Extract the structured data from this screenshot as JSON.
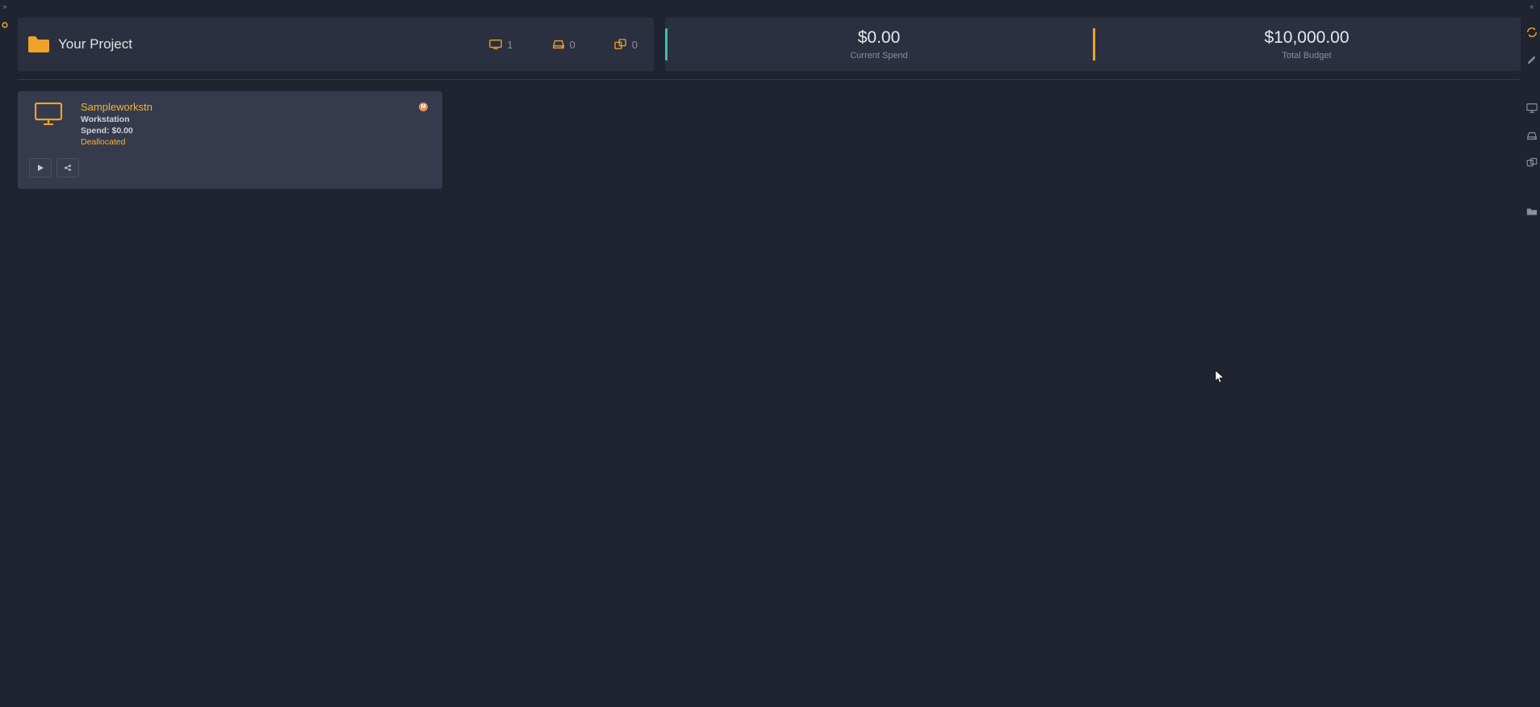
{
  "project": {
    "title": "Your Project",
    "stats": {
      "workstations": "1",
      "storage": "0",
      "render": "0"
    }
  },
  "budget": {
    "spend_amount": "$0.00",
    "spend_label": "Current Spend",
    "total_amount": "$10,000.00",
    "total_label": "Total Budget"
  },
  "resource": {
    "name": "Sampleworkstn",
    "type": "Workstation",
    "spend_line": "Spend: $0.00",
    "status": "Deallocated",
    "badge": "M"
  }
}
